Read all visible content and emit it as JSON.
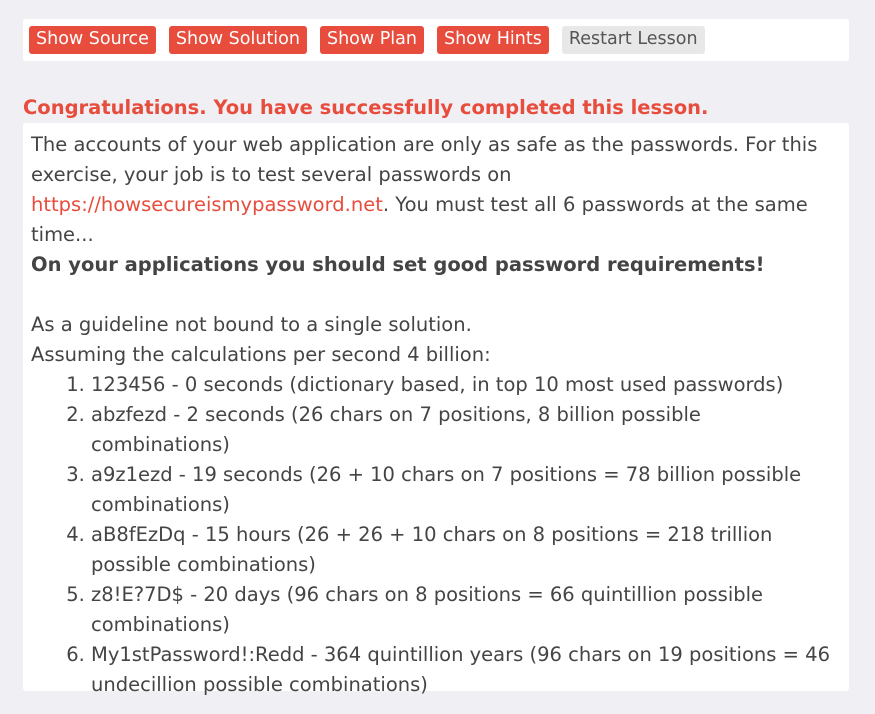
{
  "toolbar": {
    "show_source": "Show Source",
    "show_solution": "Show Solution",
    "show_plan": "Show Plan",
    "show_hints": "Show Hints",
    "restart_lesson": "Restart Lesson"
  },
  "feedback": {
    "message": "Congratulations. You have successfully completed this lesson."
  },
  "lesson": {
    "intro_before_link": "The accounts of your web application are only as safe as the passwords. For this exercise, your job is to test several passwords on ",
    "link_text": "https://howsecureismypassword.net",
    "intro_after_link": ". You must test all 6 passwords at the same time...",
    "requirement": "On your applications you should set good password requirements!",
    "guideline": "As a guideline not bound to a single solution.",
    "assumption": "Assuming the calculations per second 4 billion:",
    "passwords": [
      "123456 - 0 seconds (dictionary based, in top 10 most used passwords)",
      "abzfezd - 2 seconds (26 chars on 7 positions, 8 billion possible combinations)",
      "a9z1ezd - 19 seconds (26 + 10 chars on 7 positions = 78 billion possible combinations)",
      "aB8fEzDq - 15 hours (26 + 26 + 10 chars on 8 positions = 218 trillion possible combinations)",
      "z8!E?7D$ - 20 days (96 chars on 8 positions = 66 quintillion possible combinations)",
      "My1stPassword!:Redd - 364 quintillion years (96 chars on 19 positions = 46 undecillion possible combinations)"
    ]
  },
  "colors": {
    "accent": "#e74c3c",
    "text": "#444444",
    "background": "#f0f0f4",
    "panel": "#ffffff"
  }
}
